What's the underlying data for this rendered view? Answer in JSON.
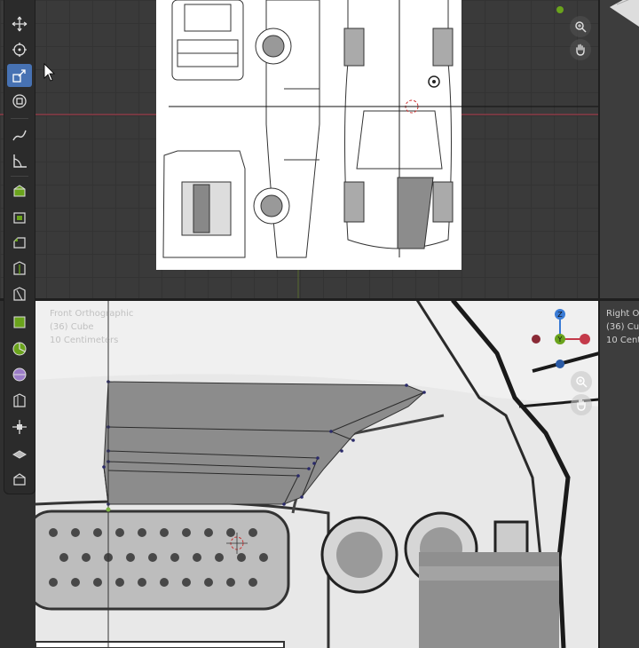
{
  "app": "Blender",
  "viewport_top": {
    "description": "Top orthographic view with car blueprint reference image"
  },
  "viewport_bottom": {
    "view_name": "Front Orthographic",
    "object_info": "(36) Cube",
    "scale_info": "10 Centimeters"
  },
  "viewport_right": {
    "view_name": "Right Ort",
    "object_info": "(36) Cu",
    "scale_info": "10 Cent"
  },
  "gizmo": {
    "z_label": "Z",
    "y_label": "Y",
    "x_label": "X"
  },
  "toolbar": {
    "tools": [
      {
        "name": "move",
        "icon": "move-icon"
      },
      {
        "name": "rotate",
        "icon": "rotate-icon"
      },
      {
        "name": "scale",
        "icon": "scale-icon",
        "active": true
      },
      {
        "name": "transform",
        "icon": "transform-icon"
      },
      {
        "name": "annotate",
        "icon": "annotate-icon"
      },
      {
        "name": "measure",
        "icon": "measure-icon"
      },
      {
        "name": "extrude",
        "icon": "extrude-icon"
      },
      {
        "name": "inset",
        "icon": "inset-icon"
      },
      {
        "name": "bevel",
        "icon": "bevel-icon"
      },
      {
        "name": "loop-cut",
        "icon": "loop-cut-icon"
      },
      {
        "name": "knife",
        "icon": "knife-icon"
      },
      {
        "name": "poly-build",
        "icon": "poly-build-icon"
      },
      {
        "name": "spin",
        "icon": "spin-icon"
      },
      {
        "name": "smooth",
        "icon": "smooth-icon"
      },
      {
        "name": "edge-slide",
        "icon": "edge-slide-icon"
      },
      {
        "name": "shrink-fatten",
        "icon": "shrink-fatten-icon"
      },
      {
        "name": "shear",
        "icon": "shear-icon"
      },
      {
        "name": "rip",
        "icon": "rip-icon"
      }
    ]
  },
  "colors": {
    "active_tool": "#4772b3",
    "x_axis": "#c43a4a",
    "y_axis": "#6aa31c",
    "z_axis": "#3a7bd5",
    "mesh_face": "#8c8c8c",
    "vertex": "#2a2a6a"
  }
}
